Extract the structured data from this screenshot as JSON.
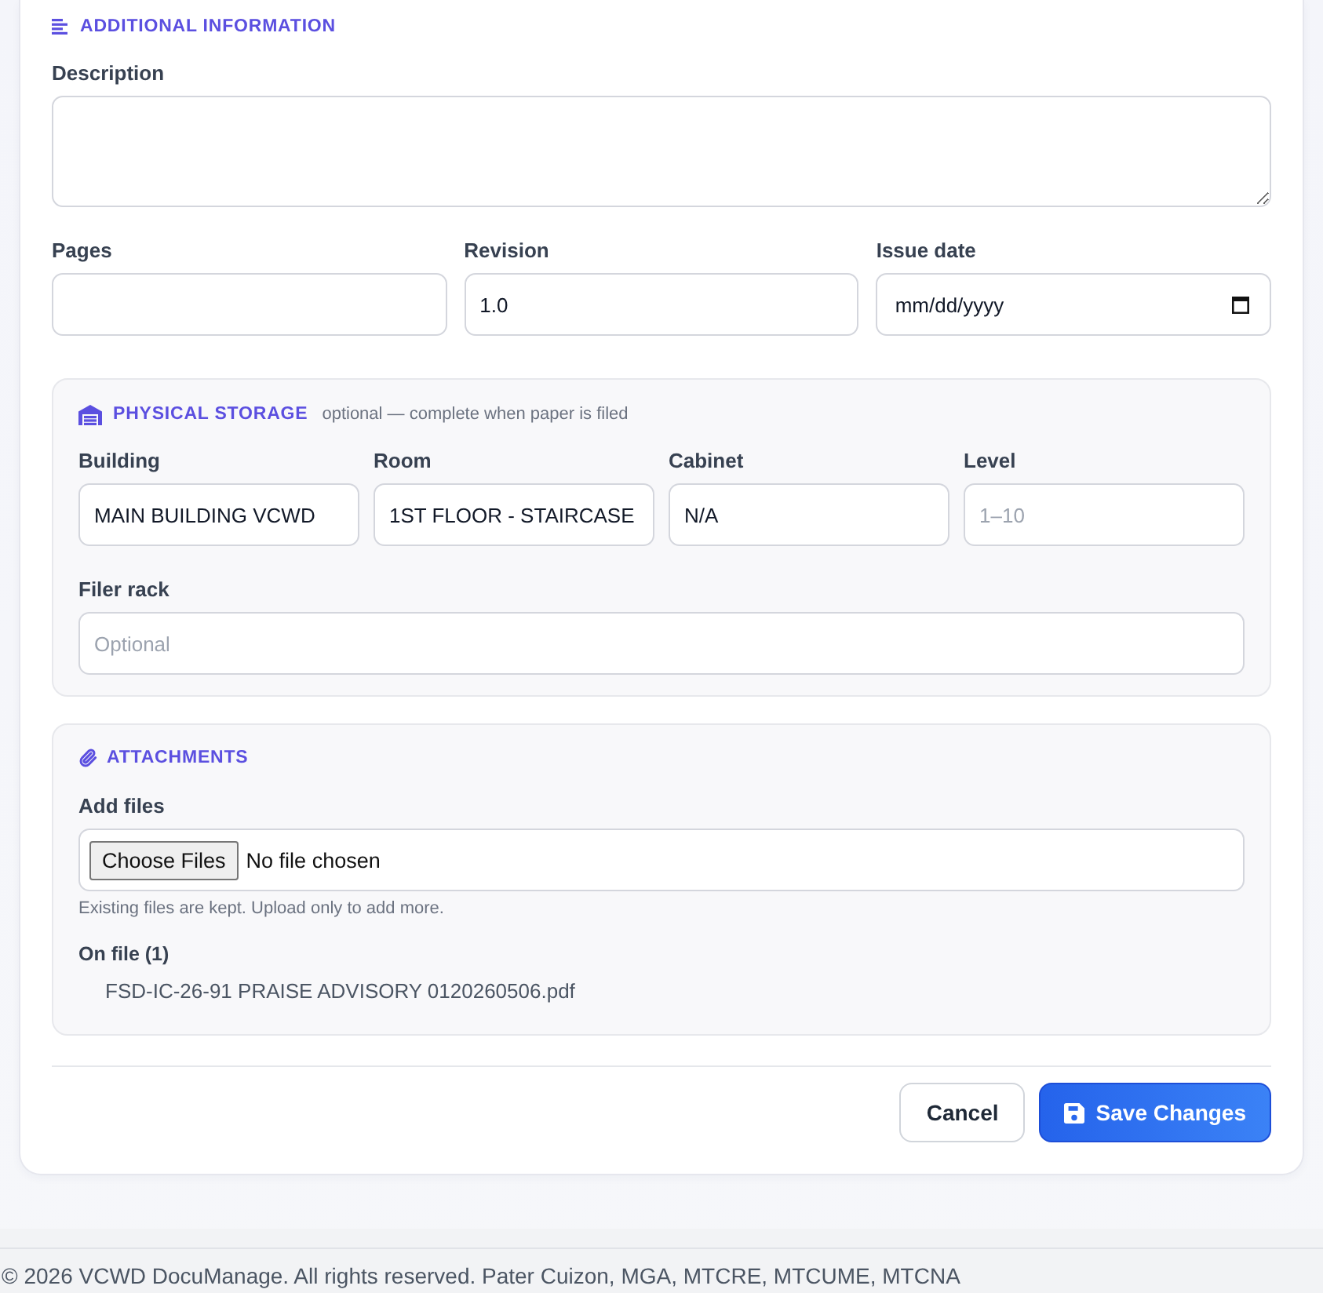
{
  "additional_information": {
    "title": "ADDITIONAL INFORMATION",
    "rows": [
      {
        "fields": [
          {
            "label": "Description",
            "kind": "textarea"
          }
        ]
      },
      {
        "fields": [
          {
            "label": "Pages",
            "kind": "text"
          },
          {
            "label": "Revision",
            "kind": "text",
            "value": "1.0"
          },
          {
            "label": "Issue date",
            "kind": "date",
            "placeholder": "mm/dd/yyyy"
          }
        ]
      }
    ]
  },
  "physical_storage": {
    "title": "PHYSICAL STORAGE",
    "note": "optional — complete when paper is filed",
    "rows": [
      {
        "fields": [
          {
            "label": "Building",
            "kind": "text",
            "value": "MAIN BUILDING VCWD"
          },
          {
            "label": "Room",
            "kind": "text",
            "value": "1ST FLOOR - STAIRCASE"
          },
          {
            "label": "Cabinet",
            "kind": "text",
            "value": "N/A"
          },
          {
            "label": "Level",
            "kind": "text",
            "placeholder": "1–10"
          }
        ]
      },
      {
        "fields": [
          {
            "label": "Filer rack",
            "kind": "text",
            "placeholder": "Optional"
          }
        ]
      }
    ]
  },
  "attachments": {
    "title": "ATTACHMENTS",
    "add_files": {
      "label": "Add files",
      "button": "Choose Files",
      "status": "No file chosen",
      "hint": "Existing files are kept. Upload only to add more."
    },
    "on_file": {
      "label": "On file (1)",
      "files": [
        "FSD-IC-26-91 PRAISE ADVISORY 0120260506.pdf"
      ]
    }
  },
  "actions": [
    {
      "label": "Cancel",
      "kind": "secondary"
    },
    {
      "label": "Save Changes",
      "kind": "primary"
    }
  ],
  "footer": {
    "text": "© 2026 VCWD DocuManage. All rights reserved. Pater Cuizon, MGA, MTCRE, MTCUME, MTCNA"
  }
}
